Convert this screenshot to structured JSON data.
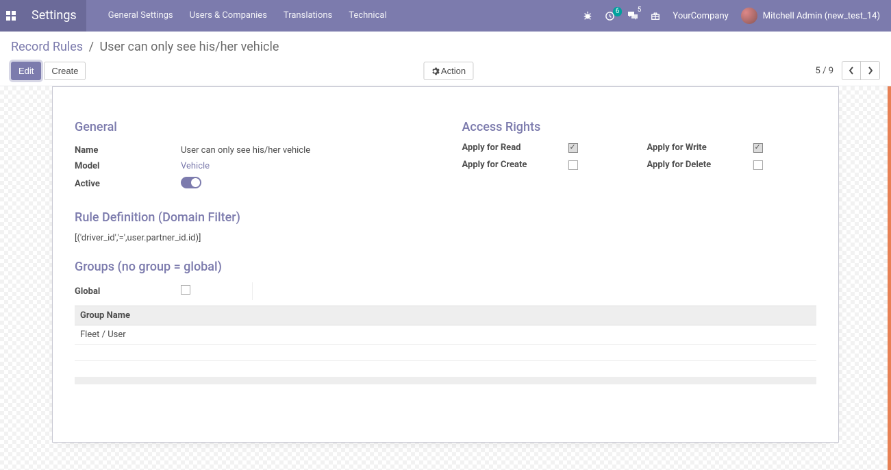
{
  "navbar": {
    "brand": "Settings",
    "menu": [
      "General Settings",
      "Users & Companies",
      "Translations",
      "Technical"
    ],
    "activity_count": "6",
    "discuss_count": "5",
    "company": "YourCompany",
    "user": "Mitchell Admin (new_test_14)"
  },
  "breadcrumb": {
    "root": "Record Rules",
    "current": "User can only see his/her vehicle"
  },
  "buttons": {
    "edit": "Edit",
    "create": "Create",
    "action": "Action"
  },
  "pager": {
    "current": "5",
    "total": "9"
  },
  "sections": {
    "general": "General",
    "access": "Access Rights",
    "rule_def": "Rule Definition (Domain Filter)",
    "groups": "Groups (no group = global)"
  },
  "general": {
    "name_label": "Name",
    "name_value": "User can only see his/her vehicle",
    "model_label": "Model",
    "model_value": "Vehicle",
    "active_label": "Active",
    "active_value": true
  },
  "access": {
    "read_label": "Apply for Read",
    "read_value": true,
    "write_label": "Apply for Write",
    "write_value": true,
    "create_label": "Apply for Create",
    "create_value": false,
    "delete_label": "Apply for Delete",
    "delete_value": false
  },
  "rule_definition": "[('driver_id','=',user.partner_id.id)]",
  "groups": {
    "global_label": "Global",
    "global_value": false,
    "column_header": "Group Name",
    "rows": [
      "Fleet / User"
    ]
  }
}
